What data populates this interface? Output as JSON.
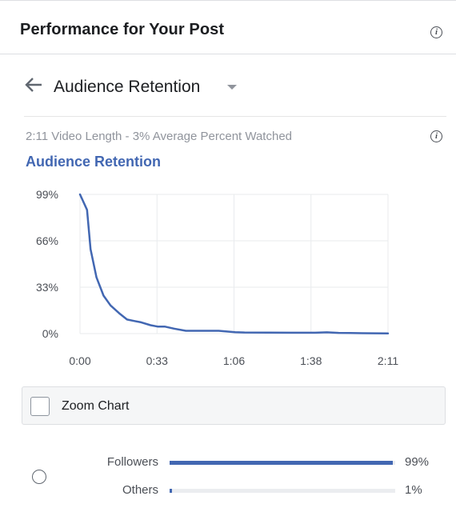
{
  "header": {
    "title": "Performance for Your Post",
    "info_icon": "info-icon"
  },
  "nav": {
    "back_icon": "arrow-left-icon",
    "title": "Audience Retention",
    "caret_icon": "caret-down-icon"
  },
  "summary": {
    "subtitle": "2:11 Video Length - 3% Average Percent Watched",
    "section_title": "Audience Retention"
  },
  "colors": {
    "accent": "#4267b2",
    "muted_text": "#90949c",
    "grid": "#e9ebee",
    "track": "#ebedf0"
  },
  "chart_data": {
    "type": "line",
    "title": "Audience Retention",
    "xlabel": "",
    "ylabel": "",
    "x_ticks": [
      "0:00",
      "0:33",
      "1:06",
      "1:38",
      "2:11"
    ],
    "y_ticks": [
      "99%",
      "66%",
      "33%",
      "0%"
    ],
    "xlim": [
      0,
      131
    ],
    "ylim": [
      0,
      99
    ],
    "grid": true,
    "series": [
      {
        "x": [
          0,
          3,
          4.5,
          7,
          10,
          13,
          17,
          20,
          23,
          26,
          30,
          33,
          36,
          40,
          45,
          52,
          59,
          66,
          70,
          80,
          90,
          100,
          105,
          110,
          115,
          120,
          125,
          131
        ],
        "y": [
          99,
          88,
          60,
          40,
          27,
          20,
          14,
          10,
          9,
          8,
          6,
          5,
          5,
          3.5,
          2,
          2,
          2,
          1,
          0.8,
          0.7,
          0.6,
          0.6,
          0.9,
          0.5,
          0.4,
          0.3,
          0.2,
          0.1
        ]
      }
    ]
  },
  "zoom": {
    "label": "Zoom Chart",
    "checked": false
  },
  "breakdown": {
    "items": [
      {
        "label": "Followers",
        "percent_text": "99%",
        "value": 99
      },
      {
        "label": "Others",
        "percent_text": "1%",
        "value": 1
      }
    ]
  }
}
